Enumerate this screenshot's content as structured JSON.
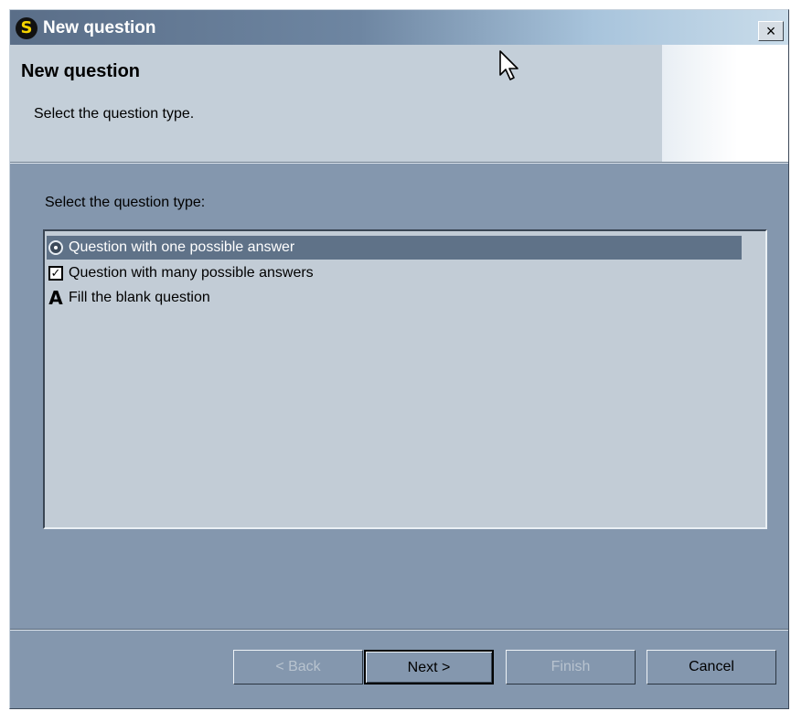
{
  "window": {
    "title": "New question",
    "app_icon_letter": "S",
    "close_symbol": "×"
  },
  "header": {
    "title": "New question",
    "subtitle": "Select the question type."
  },
  "list": {
    "label": "Select the question type:",
    "items": [
      {
        "label": "Question with one possible answer",
        "icon": "radio-button-icon",
        "selected": true
      },
      {
        "label": "Question with many possible answers",
        "icon": "checkbox-icon",
        "selected": false
      },
      {
        "label": "Fill the blank question",
        "icon": "letter-a-icon",
        "icon_text": "A",
        "selected": false
      }
    ]
  },
  "buttons": {
    "back": "< Back",
    "next": "Next >",
    "finish": "Finish",
    "cancel": "Cancel"
  },
  "colors": {
    "dialog_bg": "#8497ae",
    "header_bg": "#c4cfd9",
    "selection_bg": "#5f7288",
    "app_icon_letter": "#f5d400"
  }
}
